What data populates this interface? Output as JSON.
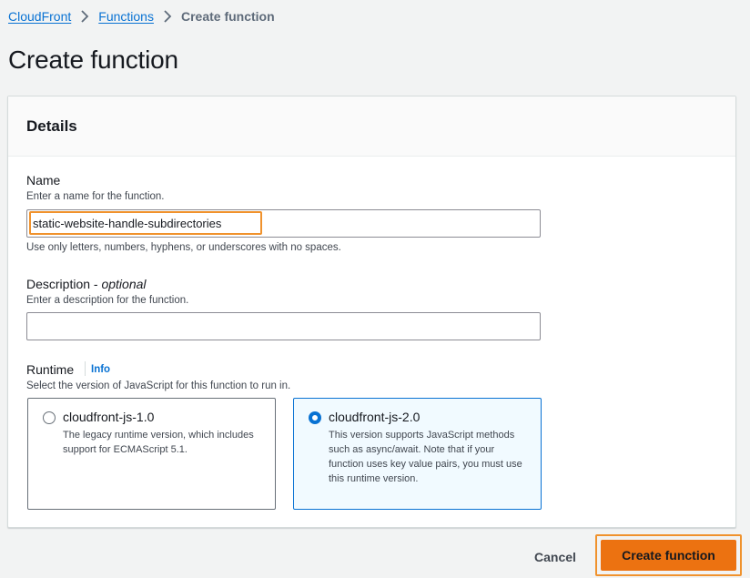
{
  "breadcrumb": {
    "items": [
      {
        "label": "CloudFront"
      },
      {
        "label": "Functions"
      },
      {
        "label": "Create function"
      }
    ]
  },
  "page": {
    "title": "Create function"
  },
  "details": {
    "title": "Details",
    "name": {
      "label": "Name",
      "description": "Enter a name for the function.",
      "value": "static-website-handle-subdirectories",
      "constraint": "Use only letters, numbers, hyphens, or underscores with no spaces."
    },
    "description": {
      "label": "Description - ",
      "label_optional": "optional",
      "description": "Enter a description for the function.",
      "value": ""
    },
    "runtime": {
      "label": "Runtime",
      "info_link": "Info",
      "description": "Select the version of JavaScript for this function to run in.",
      "options": [
        {
          "label": "cloudfront-js-1.0",
          "description": "The legacy runtime version, which includes support for ECMAScript 5.1.",
          "selected": false
        },
        {
          "label": "cloudfront-js-2.0",
          "description": "This version supports JavaScript methods such as async/await. Note that if your function uses key value pairs, you must use this runtime version.",
          "selected": true
        }
      ]
    }
  },
  "actions": {
    "cancel_label": "Cancel",
    "create_label": "Create function"
  },
  "colors": {
    "link": "#0972d3",
    "primary_button": "#ec7211",
    "highlight": "#f0922d",
    "selected_tile_bg": "#f1faff"
  }
}
